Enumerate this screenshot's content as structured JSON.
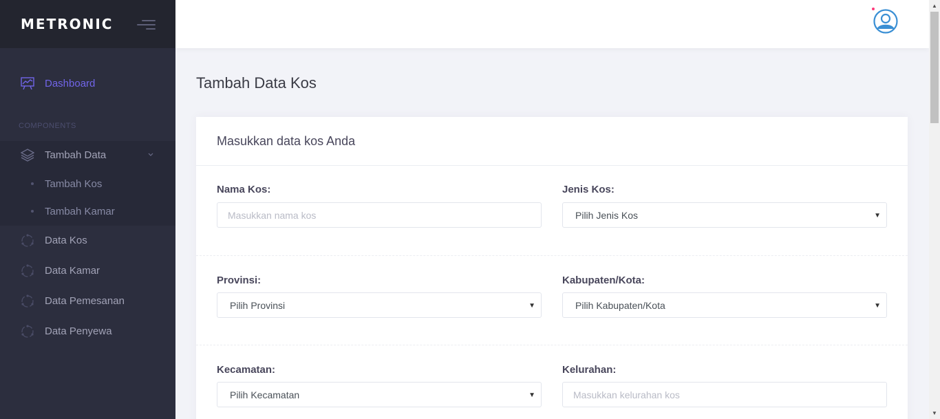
{
  "sidebar": {
    "brand": "METRONIC",
    "dashboard_label": "Dashboard",
    "section_label": "COMPONENTS",
    "tambah_data_label": "Tambah Data",
    "sub_items": [
      "Tambah Kos",
      "Tambah Kamar"
    ],
    "items": [
      "Data Kos",
      "Data Kamar",
      "Data Pemesanan",
      "Data Penyewa"
    ]
  },
  "icons": {
    "burger": "menu-toggle-icon",
    "dashboard": "chart-board-icon",
    "layers": "layers-icon",
    "chevron": "chevron-down-icon",
    "item": "circle-dots-icon",
    "avatar": "user-avatar-icon"
  },
  "colors": {
    "sidebar_bg": "#2c2e3e",
    "brand_bg": "#23252f",
    "accent": "#7165e9",
    "page_bg": "#f2f3f8",
    "avatar": "#3a8fd4"
  },
  "page": {
    "title": "Tambah Data Kos"
  },
  "form": {
    "card_title": "Masukkan data kos Anda",
    "nama_kos": {
      "label": "Nama Kos:",
      "placeholder": "Masukkan nama kos",
      "value": ""
    },
    "jenis_kos": {
      "label": "Jenis Kos:",
      "value": "Pilih Jenis Kos"
    },
    "provinsi": {
      "label": "Provinsi:",
      "value": "Pilih Provinsi"
    },
    "kabupaten": {
      "label": "Kabupaten/Kota:",
      "value": "Pilih Kabupaten/Kota"
    },
    "kecamatan": {
      "label": "Kecamatan:",
      "value": "Pilih Kecamatan"
    },
    "kelurahan": {
      "label": "Kelurahan:",
      "placeholder": "Masukkan kelurahan kos",
      "value": ""
    }
  }
}
